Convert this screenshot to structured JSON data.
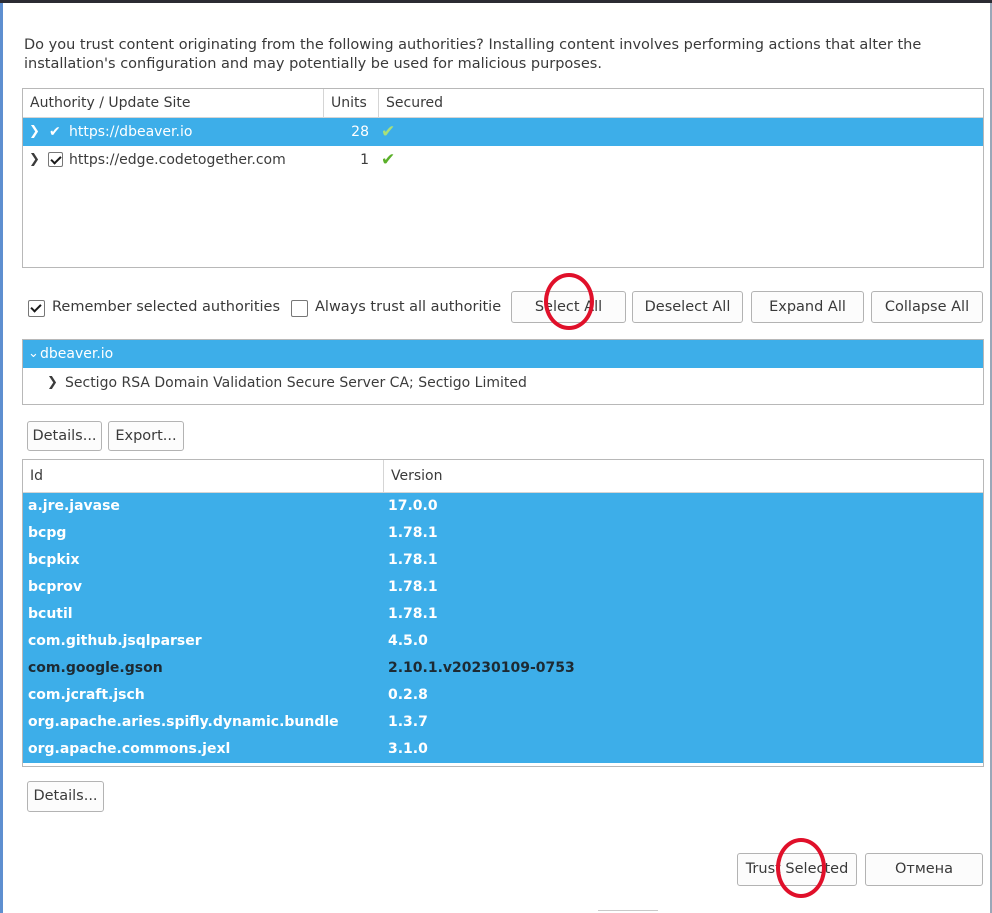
{
  "dialog": {
    "intro_text": "Do you trust content originating from the following authorities?  Installing content involves performing actions that alter the installation's configuration and may potentially be used for malicious purposes."
  },
  "authorities_table": {
    "columns": [
      "Authority / Update Site",
      "Units",
      "Secured"
    ],
    "rows": [
      {
        "site": "https://dbeaver.io",
        "units": "28",
        "secured": true,
        "checked": true,
        "selected": true
      },
      {
        "site": "https://edge.codetogether.com",
        "units": "1",
        "secured": true,
        "checked": true,
        "selected": false
      }
    ]
  },
  "options": {
    "remember_label": "Remember selected authorities",
    "remember_checked": true,
    "always_trust_label": "Always trust all authoritie",
    "always_trust_checked": false,
    "select_all": "Select All",
    "deselect_all": "Deselect All",
    "expand_all": "Expand All",
    "collapse_all": "Collapse All"
  },
  "cert_tree": {
    "root": "dbeaver.io",
    "child": "Sectigo RSA Domain Validation Secure Server CA; Sectigo Limited"
  },
  "cert_buttons": {
    "details": "Details...",
    "export": "Export..."
  },
  "units_table": {
    "columns": [
      "Id",
      "Version"
    ],
    "rows": [
      {
        "id": "a.jre.javase",
        "version": "17.0.0"
      },
      {
        "id": "bcpg",
        "version": "1.78.1"
      },
      {
        "id": "bcpkix",
        "version": "1.78.1"
      },
      {
        "id": "bcprov",
        "version": "1.78.1"
      },
      {
        "id": "bcutil",
        "version": "1.78.1"
      },
      {
        "id": "com.github.jsqlparser",
        "version": "4.5.0"
      },
      {
        "id": "com.google.gson",
        "version": "2.10.1.v20230109-0753"
      },
      {
        "id": "com.jcraft.jsch",
        "version": "0.2.8"
      },
      {
        "id": "org.apache.aries.spifly.dynamic.bundle",
        "version": "1.3.7"
      },
      {
        "id": "org.apache.commons.jexl",
        "version": "3.1.0"
      }
    ]
  },
  "bottom": {
    "details": "Details...",
    "trust_selected": "Trust Selected",
    "cancel": "Отмена"
  },
  "colors": {
    "selection": "#3daee9",
    "annotation_circle": "#e0102a",
    "secured_check": "#5bb02a"
  }
}
